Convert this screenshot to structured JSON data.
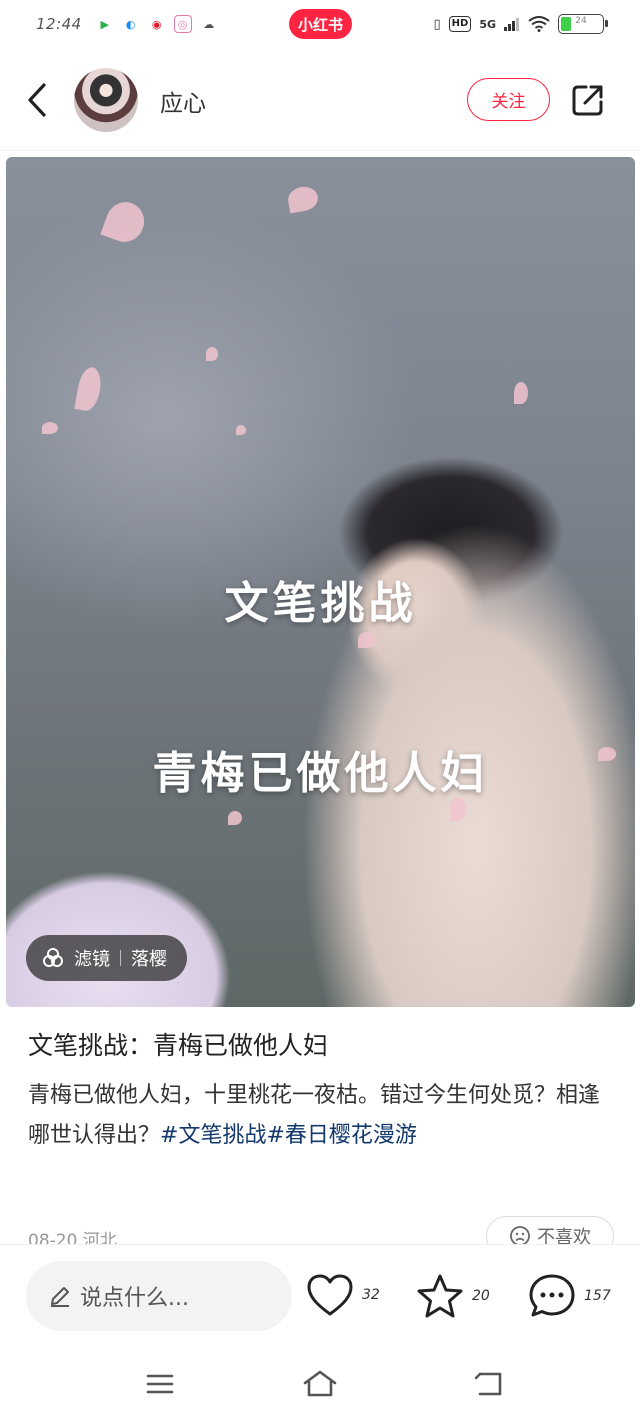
{
  "status_bar": {
    "time": "12:44",
    "brand": "小红书",
    "network": "5G",
    "hd": "HD",
    "battery_level": "24",
    "battery_color": "#3ecf4a"
  },
  "header": {
    "username": "应心",
    "follow_label": "关注"
  },
  "image": {
    "overlay_line1": "文笔挑战",
    "overlay_line2": "青梅已做他人妇",
    "filter_label": "滤镜",
    "filter_name": "落樱"
  },
  "note": {
    "title": "文笔挑战：青梅已做他人妇",
    "body_text": "青梅已做他人妇，十里桃花一夜枯。错过今生何处觅？相逢哪世认得出？",
    "tags": [
      "#文笔挑战",
      "#春日樱花漫游"
    ],
    "meta": "08-20 河北",
    "dislike_label": "不喜欢"
  },
  "bottom_bar": {
    "comment_placeholder": "说点什么...",
    "likes": "32",
    "collects": "20",
    "comments": "157"
  },
  "colors": {
    "accent": "#ff2442",
    "tag": "#13386c"
  },
  "icons": {
    "back": "chevron-left-icon",
    "share": "share-icon",
    "like": "heart-icon",
    "collect": "star-icon",
    "comment": "comment-icon",
    "edit": "pencil-icon"
  }
}
